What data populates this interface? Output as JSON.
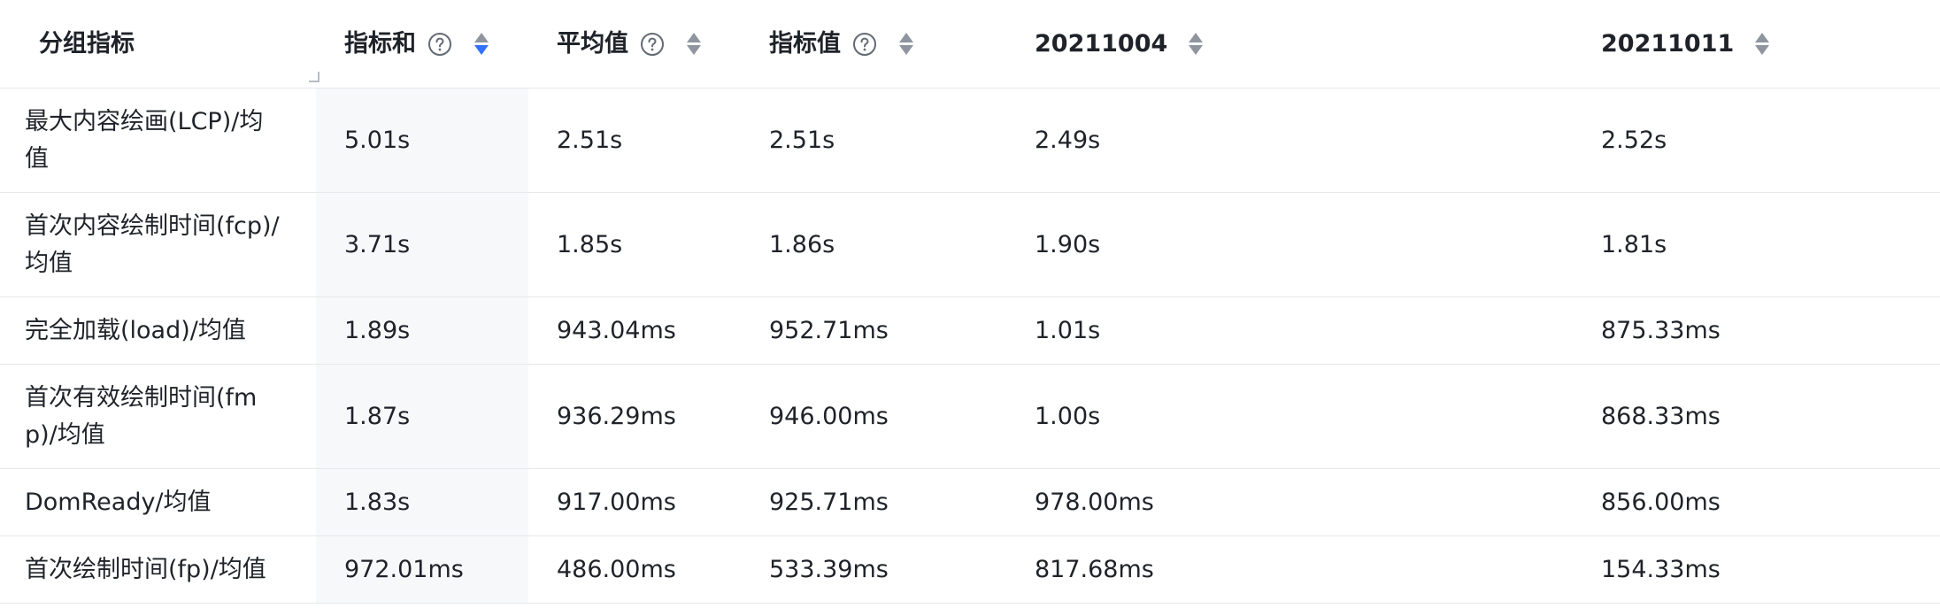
{
  "table": {
    "headers": {
      "group_metric": "分组指标",
      "metric_sum": "指标和",
      "average": "平均值",
      "metric_value": "指标值",
      "date1": "20211004",
      "date2": "20211011"
    },
    "sort_active_color": "#3370ff",
    "rows": [
      {
        "label": "最大内容绘画(LCP)/均值",
        "sum": "5.01s",
        "avg": "2.51s",
        "value": "2.51s",
        "d1": "2.49s",
        "d2": "2.52s"
      },
      {
        "label": "首次内容绘制时间(fcp)/均值",
        "sum": "3.71s",
        "avg": "1.85s",
        "value": "1.86s",
        "d1": "1.90s",
        "d2": "1.81s"
      },
      {
        "label": "完全加载(load)/均值",
        "sum": "1.89s",
        "avg": "943.04ms",
        "value": "952.71ms",
        "d1": "1.01s",
        "d2": "875.33ms"
      },
      {
        "label": "首次有效绘制时间(fmp)/均值",
        "sum": "1.87s",
        "avg": "936.29ms",
        "value": "946.00ms",
        "d1": "1.00s",
        "d2": "868.33ms"
      },
      {
        "label": "DomReady/均值",
        "sum": "1.83s",
        "avg": "917.00ms",
        "value": "925.71ms",
        "d1": "978.00ms",
        "d2": "856.00ms"
      },
      {
        "label": "首次绘制时间(fp)/均值",
        "sum": "972.01ms",
        "avg": "486.00ms",
        "value": "533.39ms",
        "d1": "817.68ms",
        "d2": "154.33ms"
      }
    ]
  }
}
